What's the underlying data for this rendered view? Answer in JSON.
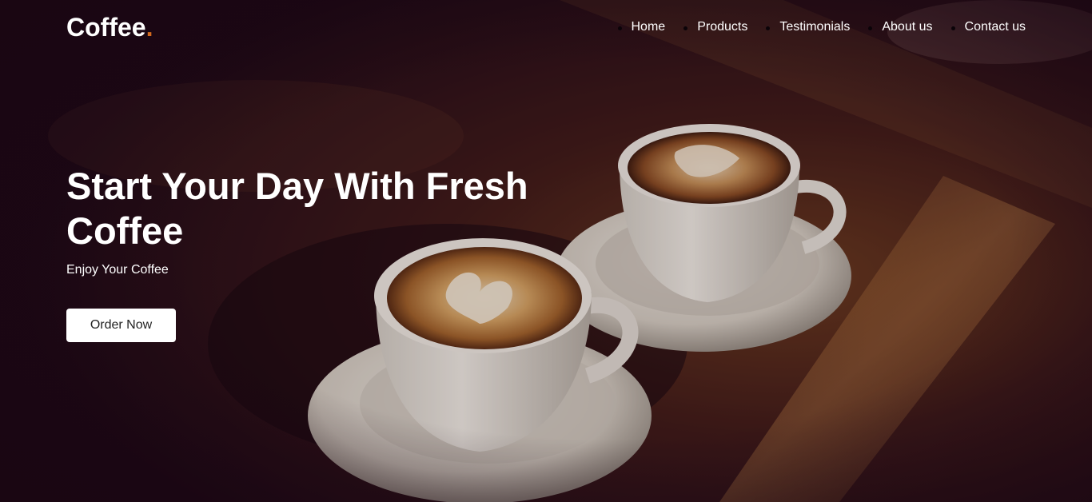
{
  "brand": {
    "name": "Coffee",
    "dot": ".",
    "accent_color": "#d2691e"
  },
  "nav": {
    "items": [
      {
        "label": "Home"
      },
      {
        "label": "Products"
      },
      {
        "label": "Testimonials"
      },
      {
        "label": "About us"
      },
      {
        "label": "Contact us"
      }
    ]
  },
  "hero": {
    "title": "Start Your Day With Fresh Coffee",
    "subtitle": "Enjoy Your Coffee",
    "cta_label": "Order Now",
    "background_description_icon": "coffee-cups-photo"
  },
  "colors": {
    "overlay": "#1d0b16",
    "text": "#ffffff",
    "button_bg": "#ffffff",
    "button_text": "#222222"
  }
}
